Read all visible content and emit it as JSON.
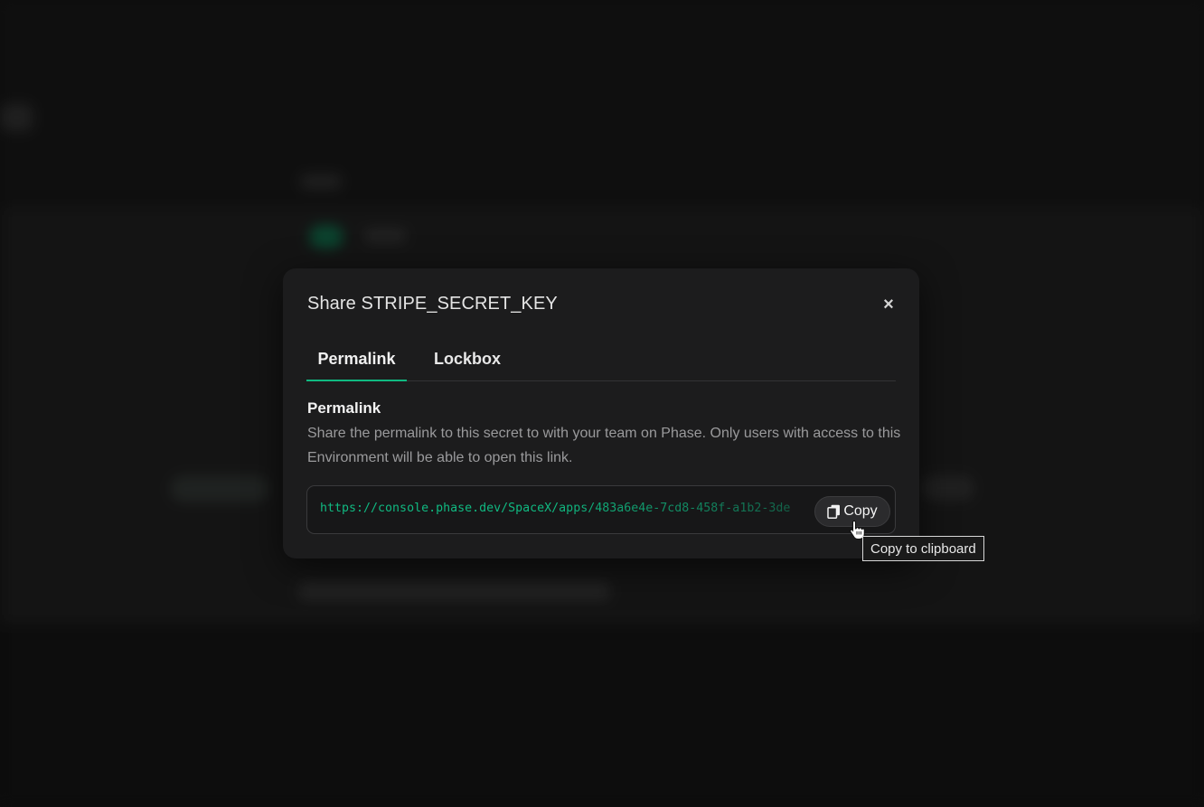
{
  "modal": {
    "title": "Share STRIPE_SECRET_KEY",
    "close_glyph": "×",
    "tabs": [
      {
        "label": "Permalink",
        "active": true
      },
      {
        "label": "Lockbox",
        "active": false
      }
    ],
    "permalink": {
      "heading": "Permalink",
      "description": "Share the permalink to this secret to with your team on Phase. Only users with access to this Environment will be able to open this link.",
      "url": "https://console.phase.dev/SpaceX/apps/483a6e4e-7cd8-458f-a1b2-3de",
      "copy_label": "Copy",
      "copy_tooltip": "Copy to clipboard"
    }
  },
  "icons": {
    "close": "close-icon",
    "copy": "copy-icon",
    "cursor": "hand-pointer-icon"
  },
  "colors": {
    "accent": "#10b981",
    "modal_bg": "#1c1c1d",
    "page_bg": "#121212"
  }
}
